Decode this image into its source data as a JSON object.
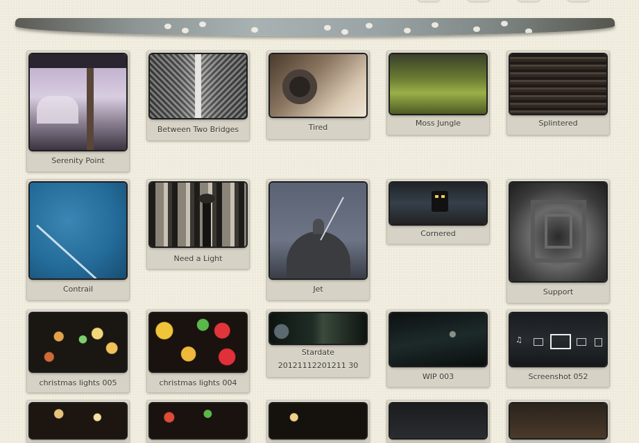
{
  "gallery": {
    "items": [
      {
        "title": "Serenity Point",
        "icon": "photo-city-signpost"
      },
      {
        "title": "Between Two Bridges",
        "icon": "photo-bridges"
      },
      {
        "title": "Tired",
        "icon": "photo-tire"
      },
      {
        "title": "Moss Jungle",
        "icon": "photo-moss"
      },
      {
        "title": "Splintered",
        "icon": "photo-wood"
      },
      {
        "title": "Contrail",
        "icon": "photo-contrail"
      },
      {
        "title": "Need a Light",
        "icon": "photo-columns-lamp"
      },
      {
        "title": "Jet",
        "icon": "photo-dome-jet"
      },
      {
        "title": "Cornered",
        "icon": "photo-train"
      },
      {
        "title": "Support",
        "icon": "photo-tunnel"
      },
      {
        "title": "christmas lights 005",
        "icon": "photo-bokeh"
      },
      {
        "title": "christmas lights 004",
        "icon": "photo-bokeh"
      },
      {
        "title": "Stardate",
        "subtitle": "20121112201211 30",
        "icon": "photo-space"
      },
      {
        "title": "WIP 003",
        "icon": "photo-space-dark"
      },
      {
        "title": "Screenshot 052",
        "icon": "photo-media-center"
      },
      {
        "title": "",
        "icon": "photo-lights"
      },
      {
        "title": "",
        "icon": "photo-lights"
      },
      {
        "title": "",
        "icon": "photo-lights"
      },
      {
        "title": "",
        "icon": "photo-dark"
      },
      {
        "title": "",
        "icon": "photo-dark"
      }
    ]
  },
  "colors": {
    "background": "#efebdc",
    "card": "#d6d2c5",
    "caption": "#3c3a35"
  }
}
